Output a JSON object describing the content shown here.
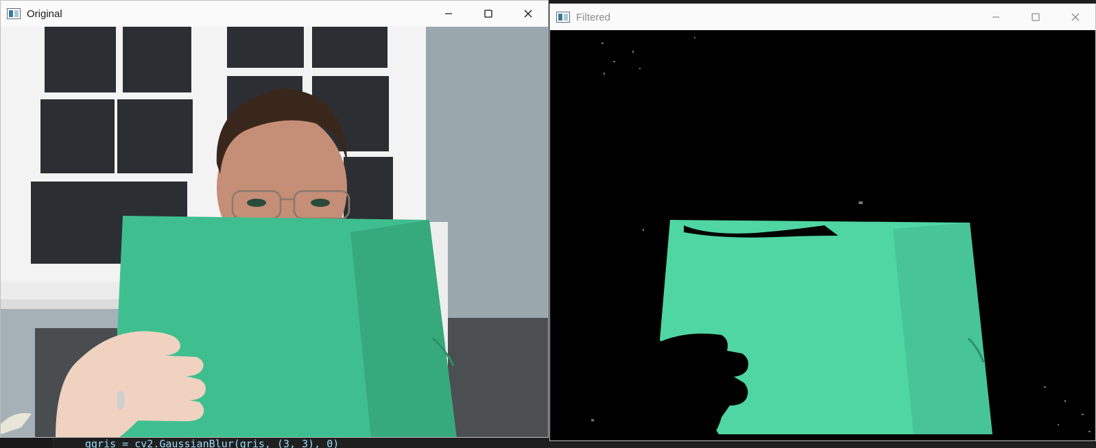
{
  "windows": {
    "original": {
      "title": "Original",
      "controls": [
        "minimize",
        "maximize",
        "close"
      ]
    },
    "filtered": {
      "title": "Filtered",
      "controls": [
        "minimize",
        "maximize",
        "close"
      ]
    }
  },
  "editor": {
    "code_line": "ggris = cv2.GaussianBlur(gris, (3, 3), 0)"
  },
  "colors": {
    "folder_green": "#3fbf8f",
    "mask_green": "#4fd6a2",
    "wall": "#a7b3b8",
    "window_frame": "#f4f4f4",
    "titlebar": "#fafafa",
    "mask_background": "#000000"
  },
  "icons": [
    "app-icon",
    "minimize-icon",
    "maximize-icon",
    "close-icon"
  ]
}
